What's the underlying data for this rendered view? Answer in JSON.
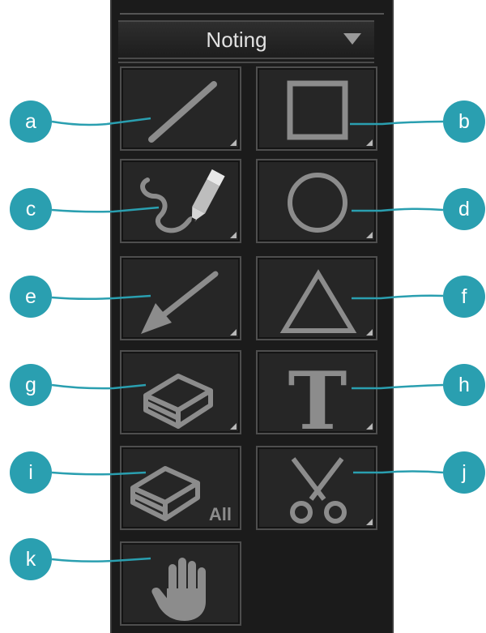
{
  "panel": {
    "title": "Noting",
    "dropdown_icon": "chevron-down-icon"
  },
  "tools": [
    {
      "letter": "a",
      "icon": "line-icon"
    },
    {
      "letter": "b",
      "icon": "rectangle-icon"
    },
    {
      "letter": "c",
      "icon": "freehand-pencil-icon"
    },
    {
      "letter": "d",
      "icon": "circle-icon"
    },
    {
      "letter": "e",
      "icon": "arrow-icon"
    },
    {
      "letter": "f",
      "icon": "triangle-icon"
    },
    {
      "letter": "g",
      "icon": "eraser-icon"
    },
    {
      "letter": "h",
      "icon": "text-icon",
      "glyph": "T"
    },
    {
      "letter": "i",
      "icon": "eraser-all-icon",
      "label": "All"
    },
    {
      "letter": "j",
      "icon": "scissors-icon"
    },
    {
      "letter": "k",
      "icon": "hand-icon"
    }
  ],
  "colors": {
    "callout": "#2a9fb0",
    "panel_bg": "#1b1b1b",
    "icon": "#8c8c8c"
  }
}
